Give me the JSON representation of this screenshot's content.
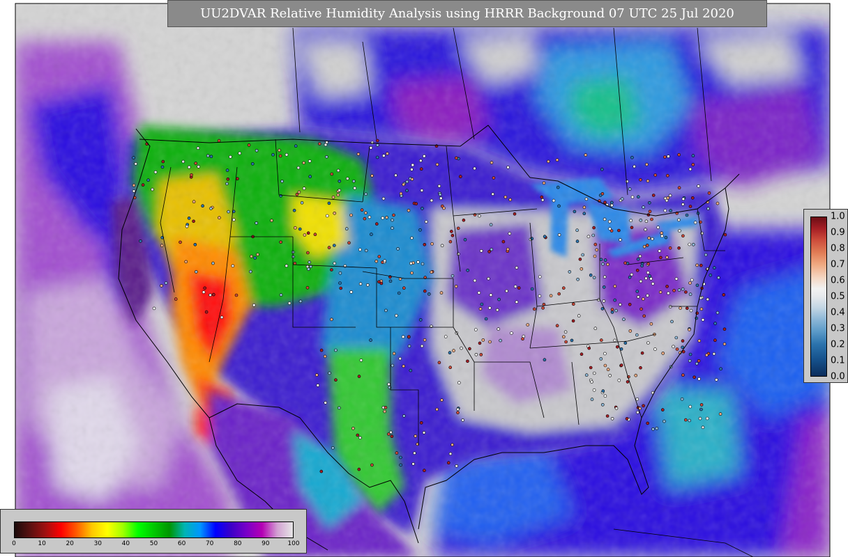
{
  "title": "UU2DVAR Relative Humidity Analysis using HRRR Background 07 UTC 25 Jul 2020",
  "rh_colorbar": {
    "ticks": [
      "0",
      "10",
      "20",
      "30",
      "40",
      "50",
      "60",
      "70",
      "80",
      "90",
      "100"
    ],
    "min": 0,
    "max": 100,
    "colors": [
      "#1a0a0a",
      "#5a1010",
      "#a01010",
      "#ff0000",
      "#ff5a00",
      "#ffc800",
      "#ffff00",
      "#a0ff00",
      "#00ff00",
      "#00c800",
      "#009600",
      "#00b4b4",
      "#0096ff",
      "#0000ff",
      "#3c00c8",
      "#7800c8",
      "#b400b4",
      "#d2a0d2",
      "#e6e6e6"
    ]
  },
  "increment_colorbar": {
    "ticks": [
      "1.0",
      "0.9",
      "0.8",
      "0.7",
      "0.6",
      "0.5",
      "0.4",
      "0.3",
      "0.2",
      "0.1",
      "0.0"
    ],
    "min": 0.0,
    "max": 1.0
  },
  "colors": {
    "ocean_purple": "#7a1fb0",
    "ocean_blue": "#2200e0",
    "dry_red": "#ff1010",
    "moist_green": "#18c818",
    "saturated_gray": "#d0d0d0",
    "title_bar": "#8a8a8a"
  }
}
